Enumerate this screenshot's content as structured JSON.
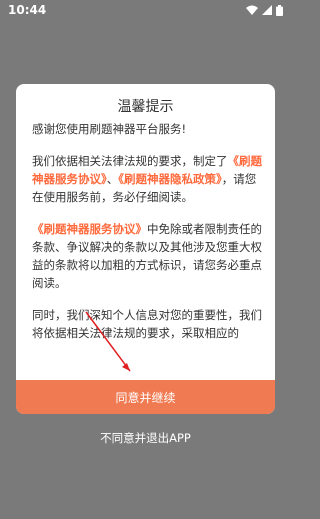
{
  "status_bar": {
    "time": "10:44"
  },
  "dialog": {
    "title": "温馨提示",
    "p1": "感谢您使用刷题神器平台服务!",
    "p2_pre": "我们依据相关法律法规的要求，制定了",
    "p2_link1": "《刷题神器服务协议》",
    "p2_mid": "、",
    "p2_link2": "《刷题神器隐私政策》",
    "p2_post": "，请您在使用服务前，务必仔细阅读。",
    "p3_link": "《刷题神器服务协议》",
    "p3_post": "中免除或者限制责任的条款、争议解决的条款以及其他涉及您重大权益的条款将以加粗的方式标识，请您务必重点阅读。",
    "p4": "同时，我们深知个人信息对您的重要性，我们将依据相关法律法规的要求，采取相应的",
    "agree_label": "同意并继续"
  },
  "disagree_label": "不同意并退出APP",
  "colors": {
    "accent": "#f07a52",
    "link": "#ff6a3d",
    "overlay": "#7a7a7a"
  }
}
